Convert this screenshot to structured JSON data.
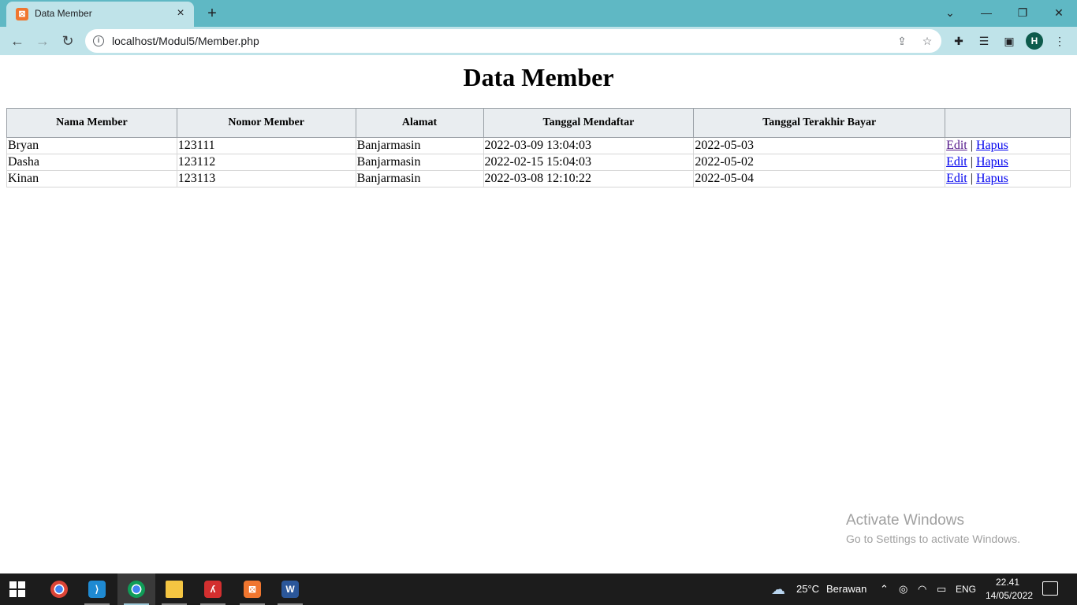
{
  "browser": {
    "tab_title": "Data Member",
    "tab_favicon": "xampp-icon",
    "tab_close": "×",
    "new_tab": "+",
    "url": "localhost/Modul5/Member.php",
    "profile_initial": "H",
    "window_controls": {
      "dropdown": "⌄",
      "minimize": "—",
      "restore": "❐",
      "close": "✕"
    },
    "nav": {
      "back": "←",
      "forward": "→",
      "reload": "↻"
    }
  },
  "page": {
    "title": "Data Member",
    "table": {
      "headers": [
        "Nama Member",
        "Nomor Member",
        "Alamat",
        "Tanggal Mendaftar",
        "Tanggal Terakhir Bayar",
        ""
      ],
      "rows": [
        {
          "nama": "Bryan",
          "nomor": "123111",
          "alamat": "Banjarmasin",
          "tgl_daftar": "2022-03-09 13:04:03",
          "tgl_bayar": "2022-05-03",
          "edit": "Edit",
          "sep": "|",
          "hapus": "Hapus"
        },
        {
          "nama": "Dasha",
          "nomor": "123112",
          "alamat": "Banjarmasin",
          "tgl_daftar": "2022-02-15 15:04:03",
          "tgl_bayar": "2022-05-02",
          "edit": "Edit",
          "sep": "|",
          "hapus": "Hapus"
        },
        {
          "nama": "Kinan",
          "nomor": "123113",
          "alamat": "Banjarmasin",
          "tgl_daftar": "2022-03-08 12:10:22",
          "tgl_bayar": "2022-05-04",
          "edit": "Edit",
          "sep": "|",
          "hapus": "Hapus"
        }
      ]
    }
  },
  "watermark": {
    "line1": "Activate Windows",
    "line2": "Go to Settings to activate Windows."
  },
  "taskbar": {
    "weather_temp": "25°C",
    "weather_text": "Berawan",
    "language": "ENG",
    "time": "22.41",
    "date": "14/05/2022",
    "apps": [
      "chrome-icon",
      "vscode-icon",
      "chrome-profile-icon",
      "file-explorer-icon",
      "acrobat-icon",
      "xampp-icon",
      "word-icon"
    ]
  },
  "colors": {
    "titlebar": "#5fb8c4",
    "toolbar": "#bfe3e9",
    "link": "#0000ee",
    "visited_link": "#551a8b",
    "header_bg": "#e9edf0"
  }
}
